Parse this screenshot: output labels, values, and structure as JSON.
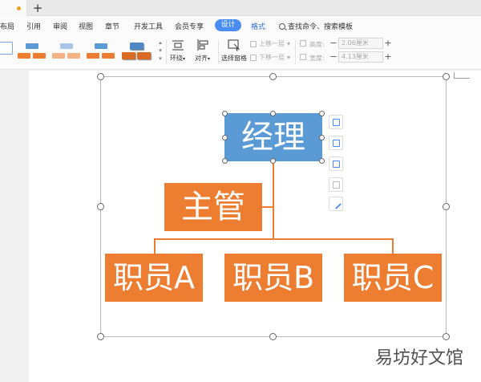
{
  "tabs": {
    "new_tab_symbol": "+"
  },
  "menu": {
    "items": [
      "布局",
      "引用",
      "审阅",
      "视图",
      "章节",
      "开发工具",
      "会员专享"
    ],
    "active": "设计",
    "format": "格式",
    "search": "查找命令、搜索模板"
  },
  "toolbar": {
    "tools": {
      "wrap": "环绕",
      "align": "对齐",
      "select_pane": "选择窗格"
    },
    "move_up": "上移一层",
    "move_down": "下移一层",
    "height_label": "高度:",
    "width_label": "宽度:",
    "height_value": "2.06厘米",
    "width_value": "4.13厘米",
    "minus": "−",
    "plus": "+"
  },
  "org_chart": {
    "manager": "经理",
    "supervisor": "主管",
    "staff": [
      "职员A",
      "职员B",
      "职员C"
    ],
    "colors": {
      "manager": "#5b9bd5",
      "others": "#ed7d31"
    }
  },
  "watermark": "易坊好文馆"
}
